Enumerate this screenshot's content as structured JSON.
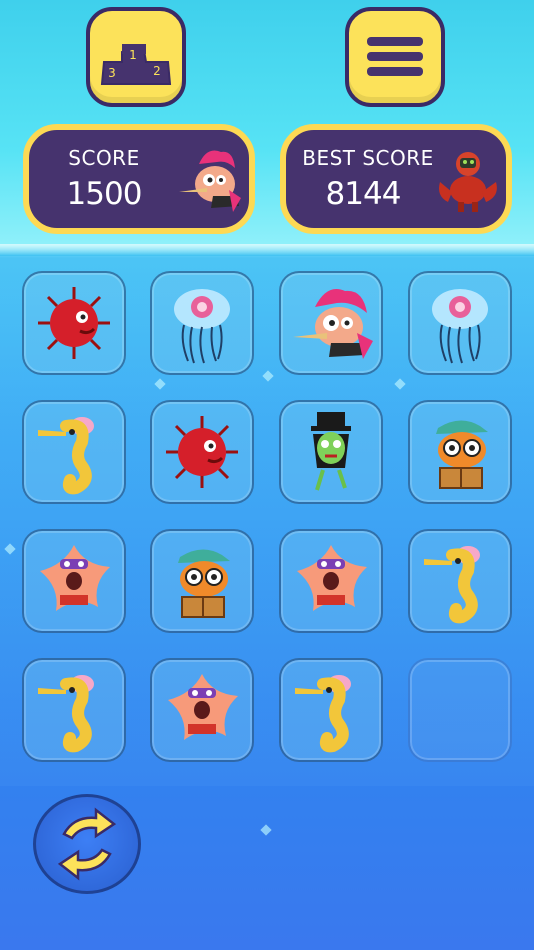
{
  "toolbar": {
    "leaderboard_icon": "podium-icon",
    "menu_icon": "hamburger-menu-icon"
  },
  "score": {
    "label": "SCORE",
    "value": "1500",
    "character": "punk-fish"
  },
  "best_score": {
    "label": "BEST SCORE",
    "value": "8144",
    "character": "armored-crab"
  },
  "podium_numbers": [
    "1",
    "2",
    "3"
  ],
  "grid": {
    "rows": [
      [
        "red-pufferfish",
        "pink-jellyfish",
        "punk-fish",
        "pink-jellyfish"
      ],
      [
        "yellow-seahorse",
        "red-pufferfish",
        "zombie-tophat",
        "cap-fish-reading"
      ],
      [
        "purple-starfish",
        "cap-fish-reading",
        "purple-starfish",
        "yellow-seahorse"
      ],
      [
        "yellow-seahorse",
        "purple-starfish",
        "yellow-seahorse",
        "empty"
      ]
    ]
  },
  "controls": {
    "shuffle_icon": "shuffle-arrows-icon"
  },
  "colors": {
    "accent": "#fce25a",
    "panel": "#46336e",
    "panel_border": "#fdd954"
  }
}
